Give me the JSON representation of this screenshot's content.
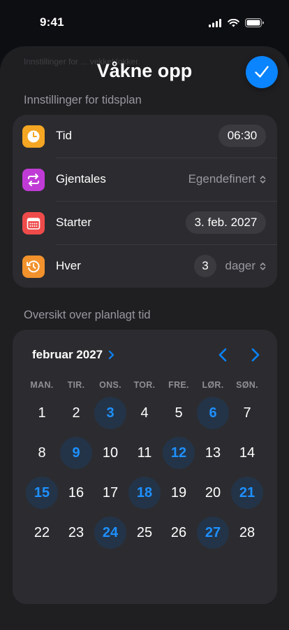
{
  "status_bar": {
    "time": "9:41"
  },
  "background_text": "Innstillinger for ... vekkeklokker.",
  "sheet": {
    "title": "Våkne opp"
  },
  "schedule_section": {
    "header": "Innstillinger for tidsplan"
  },
  "settings": {
    "time": {
      "label": "Tid",
      "value": "06:30"
    },
    "repeat": {
      "label": "Gjentales",
      "value": "Egendefinert"
    },
    "start": {
      "label": "Starter",
      "value": "3. feb. 2027"
    },
    "every": {
      "label": "Hver",
      "count": "3",
      "unit": "dager"
    }
  },
  "overview_section": {
    "header": "Oversikt over planlagt tid"
  },
  "calendar": {
    "month_label": "februar 2027",
    "weekdays": [
      "MAN.",
      "TIR.",
      "ONS.",
      "TOR.",
      "FRE.",
      "LØR.",
      "SØN."
    ],
    "weeks": [
      [
        "1",
        "2",
        "3",
        "4",
        "5",
        "6",
        "7"
      ],
      [
        "8",
        "9",
        "10",
        "11",
        "12",
        "13",
        "14"
      ],
      [
        "15",
        "16",
        "17",
        "18",
        "19",
        "20",
        "21"
      ],
      [
        "22",
        "23",
        "24",
        "25",
        "26",
        "27",
        "28"
      ]
    ],
    "scheduled_days": [
      "3",
      "6",
      "9",
      "12",
      "15",
      "18",
      "21",
      "24",
      "27"
    ]
  },
  "colors": {
    "accent": "#0a84ff",
    "time_icon": "#f5a623",
    "repeat_icon": "#c03bd6",
    "start_icon": "#ef4b4b",
    "every_icon": "#f2922c"
  },
  "icons": {
    "time": "clock-icon",
    "repeat": "repeat-icon",
    "start": "calendar-icon",
    "every": "history-icon",
    "done": "checkmark-icon"
  }
}
